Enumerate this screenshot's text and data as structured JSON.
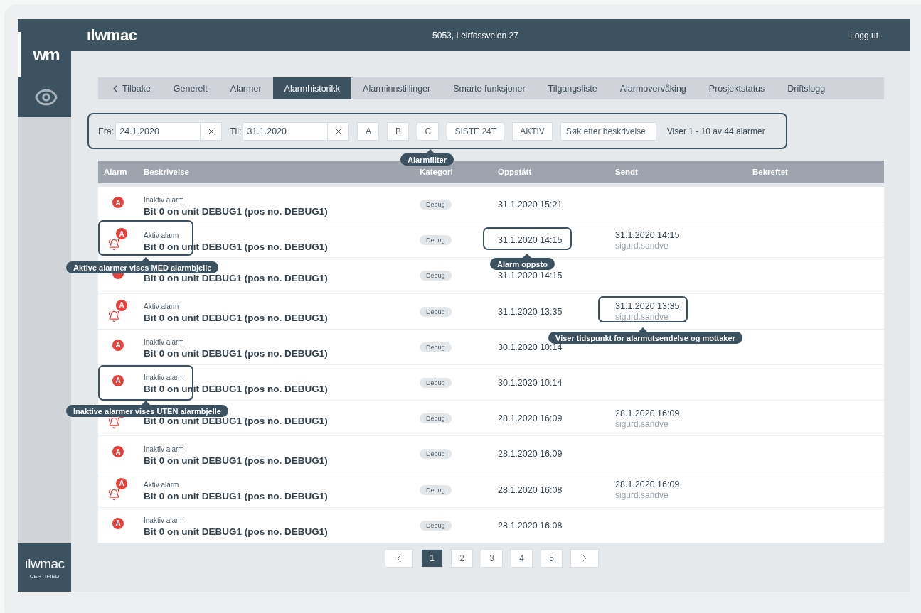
{
  "sidebar": {
    "brand_mark": "wm",
    "items": [
      {
        "kind": "brand",
        "selected": true
      },
      {
        "kind": "view",
        "selected": false
      }
    ],
    "footer_logo": "ılwmac",
    "footer_caption": "CERTIFIED"
  },
  "header": {
    "logo": "ılwmac",
    "title": "5053, Leirfossveien 27",
    "logout": "Logg ut"
  },
  "tabs": [
    {
      "label": "Tilbake",
      "kind": "back",
      "selected": false
    },
    {
      "label": "Generelt",
      "kind": "tab",
      "selected": false
    },
    {
      "label": "Alarmer",
      "kind": "tab",
      "selected": false
    },
    {
      "label": "Alarmhistorikk",
      "kind": "tab",
      "selected": true
    },
    {
      "label": "Alarminnstillinger",
      "kind": "tab",
      "selected": false
    },
    {
      "label": "Smarte funksjoner",
      "kind": "tab",
      "selected": false
    },
    {
      "label": "Tilgangsliste",
      "kind": "tab",
      "selected": false
    },
    {
      "label": "Alarmovervåking",
      "kind": "tab",
      "selected": false
    },
    {
      "label": "Prosjektstatus",
      "kind": "tab",
      "selected": false
    },
    {
      "label": "Driftslogg",
      "kind": "tab",
      "selected": false
    }
  ],
  "filter": {
    "from_label": "Fra:",
    "from_value": "24.1.2020",
    "to_label": "Til:",
    "to_value": "31.1.2020",
    "buttons": [
      "A",
      "B",
      "C",
      "SISTE 24T",
      "AKTIV"
    ],
    "search": {
      "placeholder": "Søk etter beskrivelse"
    },
    "summary": "Viser 1 - 10 av 44 alarmer"
  },
  "table": {
    "columns": [
      "Alarm",
      "Beskrivelse",
      "Kategori",
      "Oppstått",
      "Sendt",
      "Bekreftet"
    ],
    "rows": [
      {
        "class": "A",
        "active": false,
        "status": "Inaktiv alarm",
        "description": "Bit 0 on unit DEBUG1 (pos no. DEBUG1)",
        "category": "Debug",
        "occurred": "31.1.2020 15:21"
      },
      {
        "class": "A",
        "active": true,
        "status": "Aktiv alarm",
        "description": "Bit 0 on unit DEBUG1 (pos no. DEBUG1)",
        "category": "Debug",
        "occurred": "31.1.2020 14:15",
        "sent": "31.1.2020 14:15",
        "recipient": "sigurd.sandve"
      },
      {
        "active": false,
        "description": "Bit 0 on unit DEBUG1 (pos no. DEBUG1)",
        "category": "Debug",
        "occurred": "31.1.2020 14:15"
      },
      {
        "class": "A",
        "active": true,
        "status": "Aktiv alarm",
        "description": "Bit 0 on unit DEBUG1 (pos no. DEBUG1)",
        "category": "Debug",
        "occurred": "31.1.2020 13:35",
        "sent": "31.1.2020 13:35",
        "recipient": "sigurd.sandve"
      },
      {
        "class": "A",
        "active": false,
        "status": "Inaktiv alarm",
        "description": "Bit 0 on unit DEBUG1 (pos no. DEBUG1)",
        "category": "Debug",
        "occurred": "30.1.2020 10:14"
      },
      {
        "class": "A",
        "active": false,
        "status": "Inaktiv alarm",
        "description": "Bit 0 on unit DEBUG1 (pos no. DEBUG1)",
        "category": "Debug",
        "occurred": "30.1.2020 10:14"
      },
      {
        "active": true,
        "description": "Bit 0 on unit DEBUG1 (pos no. DEBUG1)",
        "category": "Debug",
        "occurred": "28.1.2020 16:09",
        "sent": "28.1.2020 16:09",
        "recipient": "sigurd.sandve"
      },
      {
        "class": "A",
        "active": false,
        "status": "Inaktiv alarm",
        "description": "Bit 0 on unit DEBUG1 (pos no. DEBUG1)",
        "category": "Debug",
        "occurred": "28.1.2020 16:09"
      },
      {
        "class": "A",
        "active": true,
        "status": "Aktiv alarm",
        "description": "Bit 0 on unit DEBUG1 (pos no. DEBUG1)",
        "category": "Debug",
        "occurred": "28.1.2020 16:08",
        "sent": "28.1.2020 16:09",
        "recipient": "sigurd.sandve"
      },
      {
        "class": "A",
        "active": false,
        "status": "Inaktiv alarm",
        "description": "Bit 0 on unit DEBUG1 (pos no. DEBUG1)",
        "category": "Debug",
        "occurred": "28.1.2020 16:08"
      }
    ]
  },
  "pagination": {
    "pages": [
      {
        "label": "1",
        "selected": true
      },
      {
        "label": "2",
        "selected": false
      },
      {
        "label": "3",
        "selected": false
      },
      {
        "label": "4",
        "selected": false
      },
      {
        "label": "5",
        "selected": false
      }
    ]
  },
  "annotations": [
    {
      "text": "Alarmfilter"
    },
    {
      "text": "Aktive alarmer vises MED alarmbjelle"
    },
    {
      "text": "Alarm oppsto"
    },
    {
      "text": "Viser tidspunkt for alarmutsendelse og mottaker"
    },
    {
      "text": "Inaktive alarmer vises UTEN alarmbjelle"
    }
  ]
}
